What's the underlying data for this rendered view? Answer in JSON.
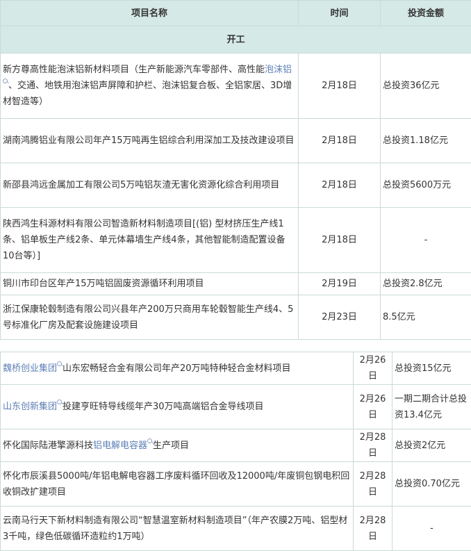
{
  "header": {
    "name": "项目名称",
    "time": "时间",
    "amount": "投资金额"
  },
  "section": "开工",
  "rows1": [
    {
      "pre": "新方尊高性能泡沫铝新材料项目（生产新能源汽车零部件、高性能",
      "link": "泡沫铝",
      "post": "、交通、地铁用泡沫铝声屏障和护栏、泡沫铝复合板、全铝家居、3D增材智造等）",
      "time": "2月18日",
      "amount": "总投资36亿元"
    },
    {
      "text": "湖南鸿腾铝业有限公司年产15万吨再生铝综合利用深加工及技改建设项目",
      "time": "2月18日",
      "amount": "总投资1.18亿元"
    },
    {
      "text": "新邵县鸿远金属加工有限公司5万吨铝灰渣无害化资源化综合利用项目",
      "time": "2月18日",
      "amount": "总投资5600万元"
    },
    {
      "text": "陕西鸿生科源材料有限公司智造新材料制造项目[(铝) 型材挤压生产线1条、铝单板生产线2条、单元体幕墙生产线4条，其他智能制造配置设备10台等）]",
      "time": "2月18日",
      "amount": "-"
    },
    {
      "text": "铜川市印台区年产15万吨铝固废资源循环利用项目",
      "time": "2月19日",
      "amount": "总投资2.8亿元"
    },
    {
      "text": "浙江保康轮毂制造有限公司兴县年产200万只商用车轮毂智能生产线4、5号标准化厂房及配套设施建设项目",
      "time": "2月23日",
      "amount": "8.5亿元"
    }
  ],
  "rows2": [
    {
      "link": "魏桥创业集团",
      "post": "山东宏畅轻合金有限公司年产20万吨特种轻合金材料项目",
      "time": "2月26日",
      "amount": "总投资15亿元"
    },
    {
      "link": "山东创新集团",
      "post": "投建亨旺特导线缆年产30万吨高端铝合金导线项目",
      "time": "2月26日",
      "amount": "一期二期合计总投资13.4亿元"
    },
    {
      "pre": "怀化国际陆港擎源科技",
      "link": "铝电解电容器",
      "post": "生产项目",
      "time": "2月28日",
      "amount": "总投资2亿元"
    },
    {
      "text": "怀化市辰溪县5000吨/年铝电解电容器工序废料循环回收及12000吨/年废铜包钢电积回收铜改扩建项目",
      "time": "2月28日",
      "amount": "总投资0.70亿元"
    },
    {
      "text": "云南马行天下新材料制造有限公司“智慧温室新材料制造项目”（年产农膜2万吨、铝型材3千吨，绿色低碳循环造粒约1万吨）",
      "time": "2月28日",
      "amount": "-"
    }
  ]
}
